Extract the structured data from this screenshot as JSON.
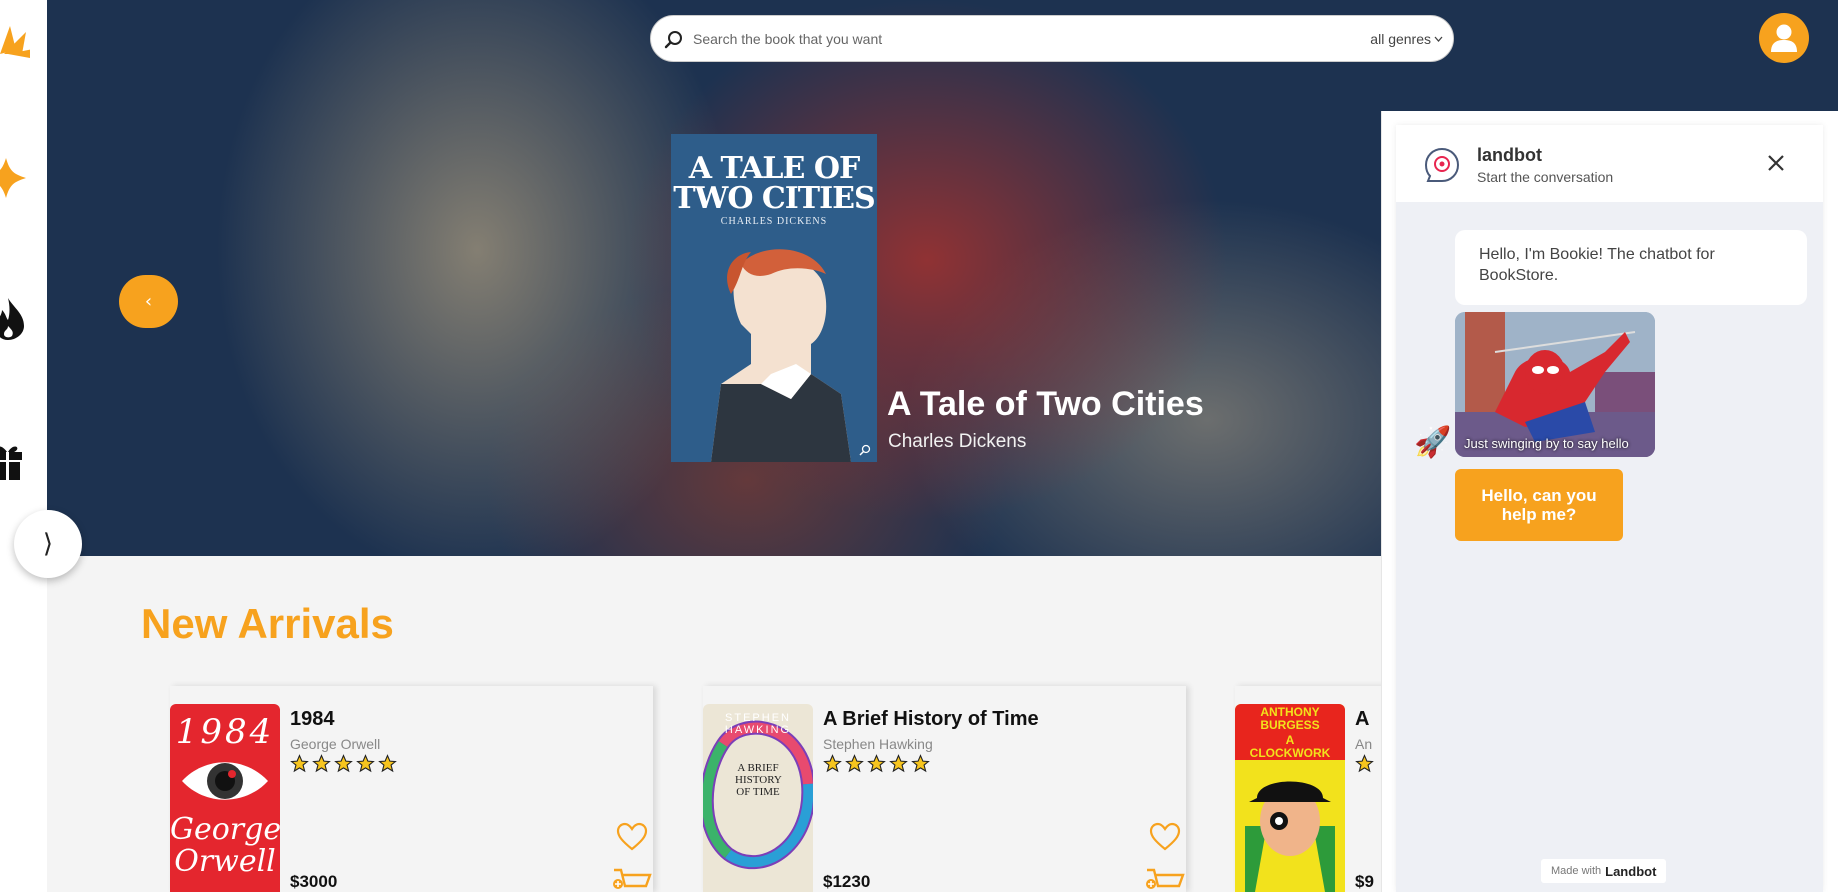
{
  "search": {
    "placeholder": "Search the book that you want",
    "genre": "all genres"
  },
  "hero": {
    "title": "A Tale of Two Cities",
    "author": "Charles Dickens",
    "cover_title": "A TALE OF TWO CITIES",
    "cover_author": "CHARLES DICKENS"
  },
  "section": {
    "title": "New Arrivals"
  },
  "books": [
    {
      "title": "1984",
      "author": "George Orwell",
      "price": "$3000",
      "rating": 5,
      "cover_line1": "1984",
      "cover_line2": "George",
      "cover_line3": "Orwell"
    },
    {
      "title": "A Brief History of Time",
      "author": "Stephen Hawking",
      "price": "$1230",
      "rating": 5,
      "cover_author": "STEPHEN HAWKING",
      "cover_title": "A BRIEF HISTORY OF TIME"
    },
    {
      "title": "A",
      "author": "An",
      "price": "$9",
      "rating": 5,
      "cover_author": "ANTHONY BURGESS",
      "cover_title": "A CLOCKWORK ORANGE"
    }
  ],
  "chat": {
    "name": "landbot",
    "subtitle": "Start the conversation",
    "message": "Hello, I'm Bookie! The chatbot for BookStore.",
    "gif_caption": "Just swinging by to say hello",
    "reply": "Hello, can you help me?",
    "made_with": "Made with",
    "brand": "Landbot"
  },
  "colors": {
    "accent": "#f7a21e",
    "hero_bg": "#1d3250"
  },
  "icons": {
    "prev": "‹",
    "next": "⟩",
    "rocket": "🚀"
  }
}
